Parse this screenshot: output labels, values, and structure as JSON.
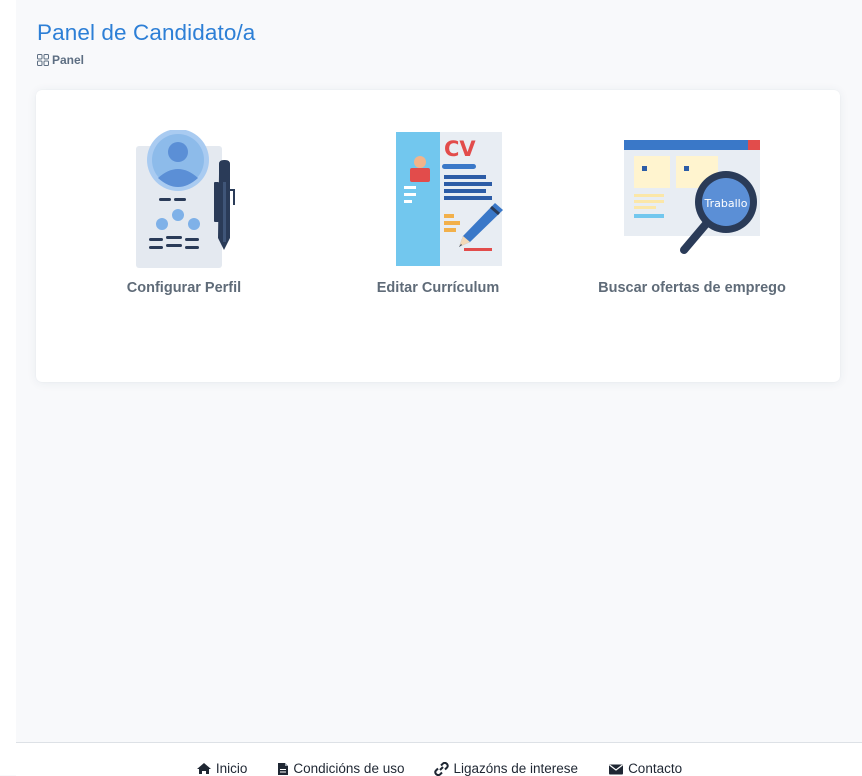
{
  "header": {
    "title": "Panel de Candidato/a",
    "breadcrumb": "Panel"
  },
  "tiles": [
    {
      "label": "Configurar Perfil",
      "icon": "profile-document-pen-icon"
    },
    {
      "label": "Editar Currículum",
      "icon": "cv-edit-icon",
      "badge": "CV"
    },
    {
      "label": "Buscar ofertas de emprego",
      "icon": "job-search-magnifier-icon",
      "badge": "Traballo"
    }
  ],
  "footer": {
    "links": [
      {
        "label": "Inicio",
        "icon": "home-icon"
      },
      {
        "label": "Condicións de uso",
        "icon": "document-icon"
      },
      {
        "label": "Ligazóns de interese",
        "icon": "link-icon"
      },
      {
        "label": "Contacto",
        "icon": "envelope-icon"
      }
    ]
  }
}
